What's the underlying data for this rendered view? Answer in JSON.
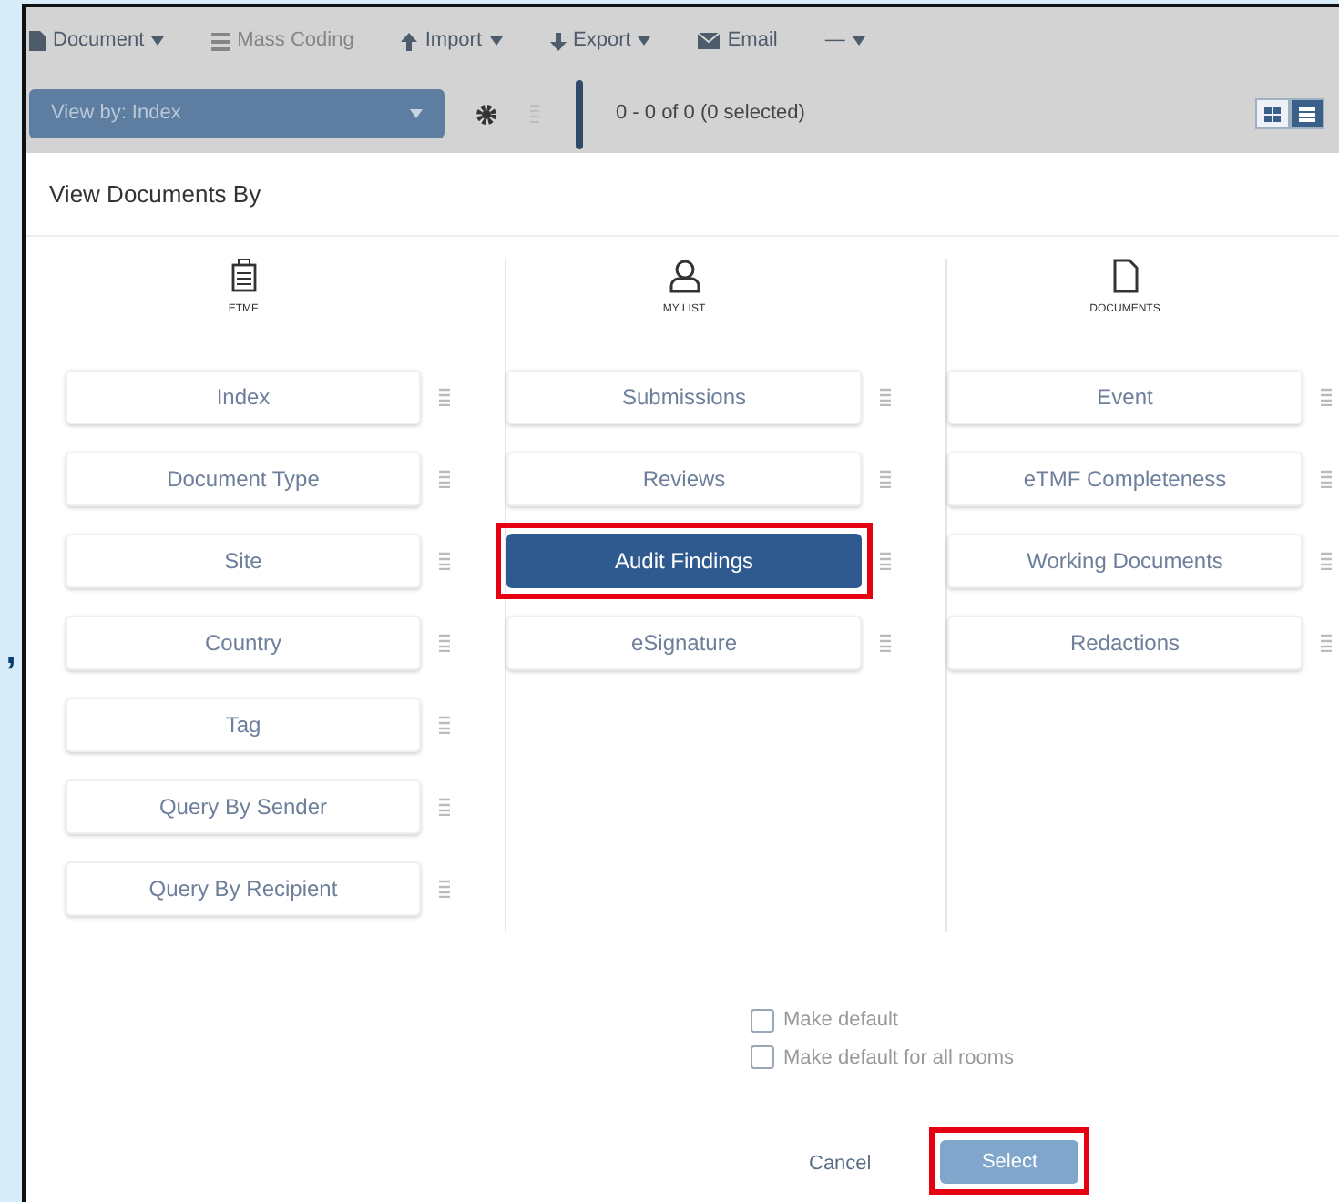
{
  "margin_mark": ",",
  "toolbar": {
    "items": [
      {
        "label": "Document",
        "kind": "menu",
        "disabled": false
      },
      {
        "label": "Mass Coding",
        "kind": "button",
        "disabled": true
      },
      {
        "label": "Import",
        "kind": "menu",
        "disabled": false
      },
      {
        "label": "Export",
        "kind": "menu",
        "disabled": false
      },
      {
        "label": "Email",
        "kind": "button",
        "disabled": false
      },
      {
        "label": "—",
        "kind": "menu",
        "disabled": false
      }
    ]
  },
  "view_select": {
    "value": "View by: Index"
  },
  "pager": "0 - 0 of 0 (0 selected)",
  "view_toggle": [
    {
      "selected": false
    },
    {
      "selected": true
    }
  ],
  "dialog": {
    "title": "View Documents By",
    "columns": [
      {
        "label": "ETMF",
        "items": [
          {
            "label": "Index",
            "selected": false,
            "highlighted": false
          },
          {
            "label": "Document Type",
            "selected": false,
            "highlighted": false
          },
          {
            "label": "Site",
            "selected": false,
            "highlighted": false
          },
          {
            "label": "Country",
            "selected": false,
            "highlighted": false
          },
          {
            "label": "Tag",
            "selected": false,
            "highlighted": false
          },
          {
            "label": "Query By Sender",
            "selected": false,
            "highlighted": false
          },
          {
            "label": "Query By Recipient",
            "selected": false,
            "highlighted": false
          }
        ]
      },
      {
        "label": "MY LIST",
        "items": [
          {
            "label": "Submissions",
            "selected": false,
            "highlighted": false
          },
          {
            "label": "Reviews",
            "selected": false,
            "highlighted": false
          },
          {
            "label": "Audit Findings",
            "selected": true,
            "highlighted": true
          },
          {
            "label": "eSignature",
            "selected": false,
            "highlighted": false
          }
        ]
      },
      {
        "label": "DOCUMENTS",
        "items": [
          {
            "label": "Event",
            "selected": false,
            "highlighted": false
          },
          {
            "label": "eTMF Completeness",
            "selected": false,
            "highlighted": false
          },
          {
            "label": "Working Documents",
            "selected": false,
            "highlighted": false
          },
          {
            "label": "Redactions",
            "selected": false,
            "highlighted": false
          }
        ]
      }
    ],
    "options": [
      {
        "label": "Make default",
        "checked": false
      },
      {
        "label": "Make default for all rooms",
        "checked": false
      }
    ],
    "buttons": [
      {
        "label": "Cancel",
        "kind": "link",
        "highlighted": false
      },
      {
        "label": "Select",
        "kind": "primary",
        "highlighted": true
      }
    ]
  }
}
